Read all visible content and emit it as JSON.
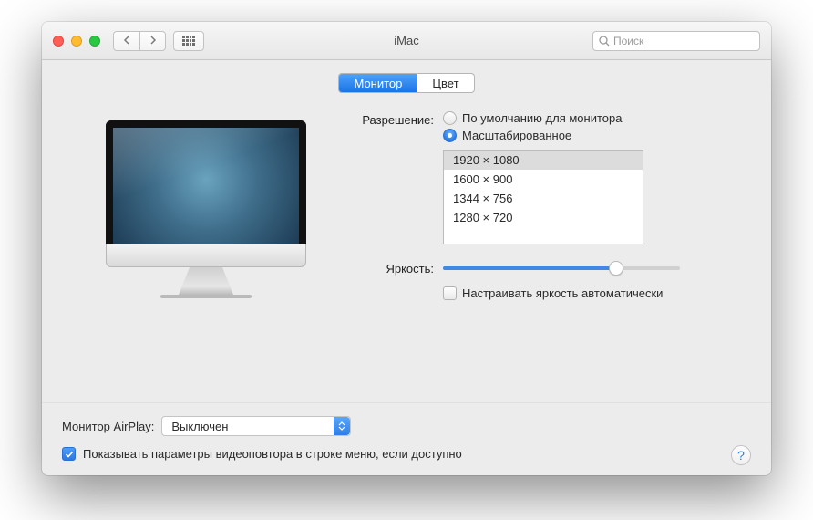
{
  "window": {
    "title": "iMac"
  },
  "toolbar": {
    "search_placeholder": "Поиск"
  },
  "tabs": {
    "monitor": "Монитор",
    "color": "Цвет",
    "active_index": 0
  },
  "resolution": {
    "label": "Разрешение:",
    "option_default": "По умолчанию для монитора",
    "option_scaled": "Масштабированное",
    "selected": "scaled",
    "list": [
      "1920 × 1080",
      "1600 × 900",
      "1344 × 756",
      "1280 × 720"
    ],
    "list_selected_index": 0
  },
  "brightness": {
    "label": "Яркость:",
    "value_percent": 73,
    "auto_label": "Настраивать яркость автоматически",
    "auto_checked": false
  },
  "airplay": {
    "label": "Монитор AirPlay:",
    "value": "Выключен"
  },
  "menubar": {
    "label": "Показывать параметры видеоповтора в строке меню, если доступно",
    "checked": true
  },
  "help_glyph": "?"
}
